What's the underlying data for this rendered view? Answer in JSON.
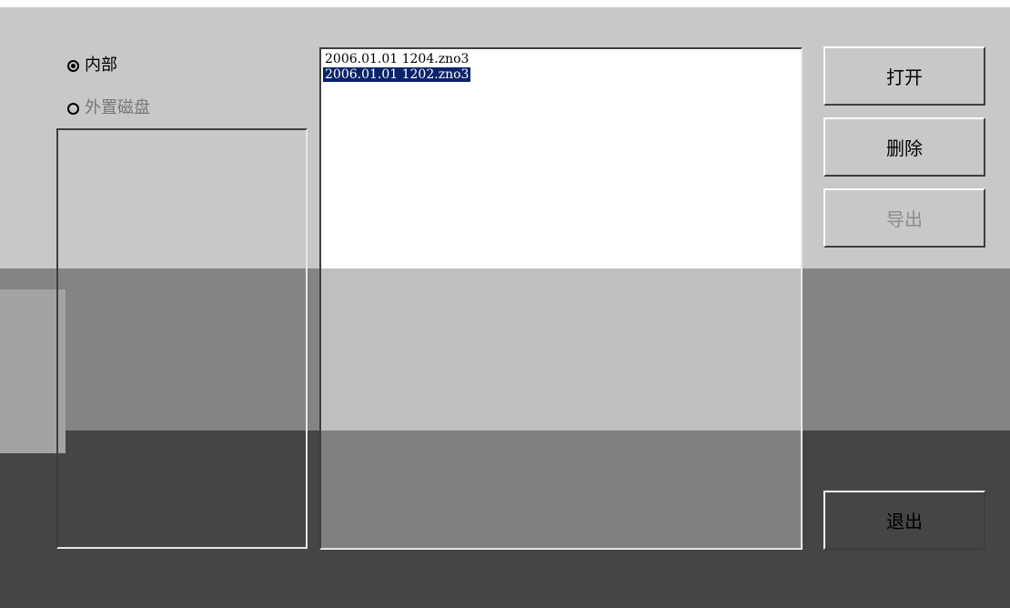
{
  "storage": {
    "internal_label": "内部",
    "external_label": "外置磁盘",
    "selected": "internal"
  },
  "files": [
    {
      "name": "2006.01.01 1204.zno3",
      "selected": false
    },
    {
      "name": "2006.01.01 1202.zno3",
      "selected": true
    }
  ],
  "buttons": {
    "open_label": "打开",
    "delete_label": "删除",
    "export_label": "导出",
    "exit_label": "退出"
  },
  "colors": {
    "selection": "#0a246a",
    "disabled_text": "#8c8c8c"
  }
}
